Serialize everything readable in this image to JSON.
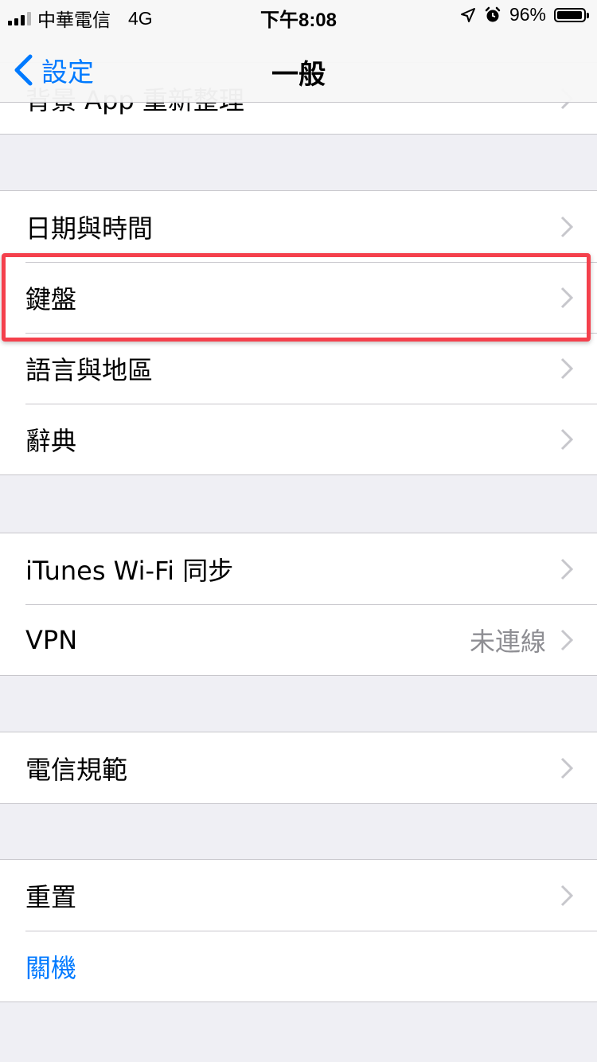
{
  "status_bar": {
    "carrier": "中華電信",
    "network": "4G",
    "time": "下午8:08",
    "battery": "96%"
  },
  "nav": {
    "back_label": "設定",
    "title": "一般"
  },
  "groups": [
    {
      "rows": [
        {
          "label": "背景 App 重新整理",
          "value": ""
        }
      ]
    },
    {
      "rows": [
        {
          "label": "日期與時間",
          "value": ""
        },
        {
          "label": "鍵盤",
          "value": ""
        },
        {
          "label": "語言與地區",
          "value": ""
        },
        {
          "label": "辭典",
          "value": ""
        }
      ]
    },
    {
      "rows": [
        {
          "label": "iTunes Wi-Fi 同步",
          "value": ""
        },
        {
          "label": "VPN",
          "value": "未連線"
        }
      ]
    },
    {
      "rows": [
        {
          "label": "電信規範",
          "value": ""
        }
      ]
    },
    {
      "rows": [
        {
          "label": "重置",
          "value": ""
        },
        {
          "label": "關機",
          "value": ""
        }
      ]
    }
  ],
  "colors": {
    "accent": "#007aff",
    "highlight": "#f4404c",
    "background": "#efeff4"
  }
}
